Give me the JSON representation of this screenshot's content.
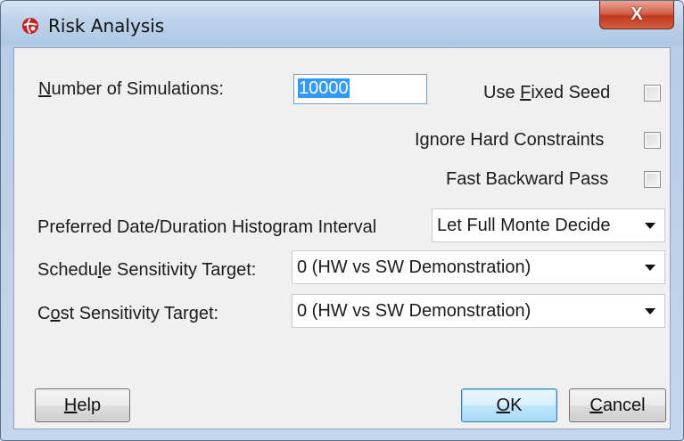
{
  "window": {
    "title": "Risk Analysis",
    "close_label": "X"
  },
  "fields": {
    "num_simulations_label": "Number of Simulations:",
    "num_simulations_value": "10000",
    "use_fixed_seed_label": "Use Fixed Seed",
    "use_fixed_seed_checked": false,
    "ignore_hard_constraints_label": "Ignore Hard Constraints",
    "ignore_hard_constraints_checked": false,
    "fast_backward_pass_label": "Fast Backward Pass",
    "fast_backward_pass_checked": false,
    "histogram_interval_label": "Preferred Date/Duration Histogram Interval",
    "histogram_interval_value": "Let Full Monte Decide",
    "schedule_target_label": "Schedule Sensitivity Target:",
    "schedule_target_value": "0 (HW vs SW Demonstration)",
    "cost_target_label": "Cost Sensitivity Target:",
    "cost_target_value": "0 (HW vs SW Demonstration)"
  },
  "buttons": {
    "help": "Help",
    "ok": "OK",
    "cancel": "Cancel"
  },
  "colors": {
    "selection": "#3399ff",
    "close_button": "#c0391f",
    "default_button_border": "#3c7fb1"
  }
}
